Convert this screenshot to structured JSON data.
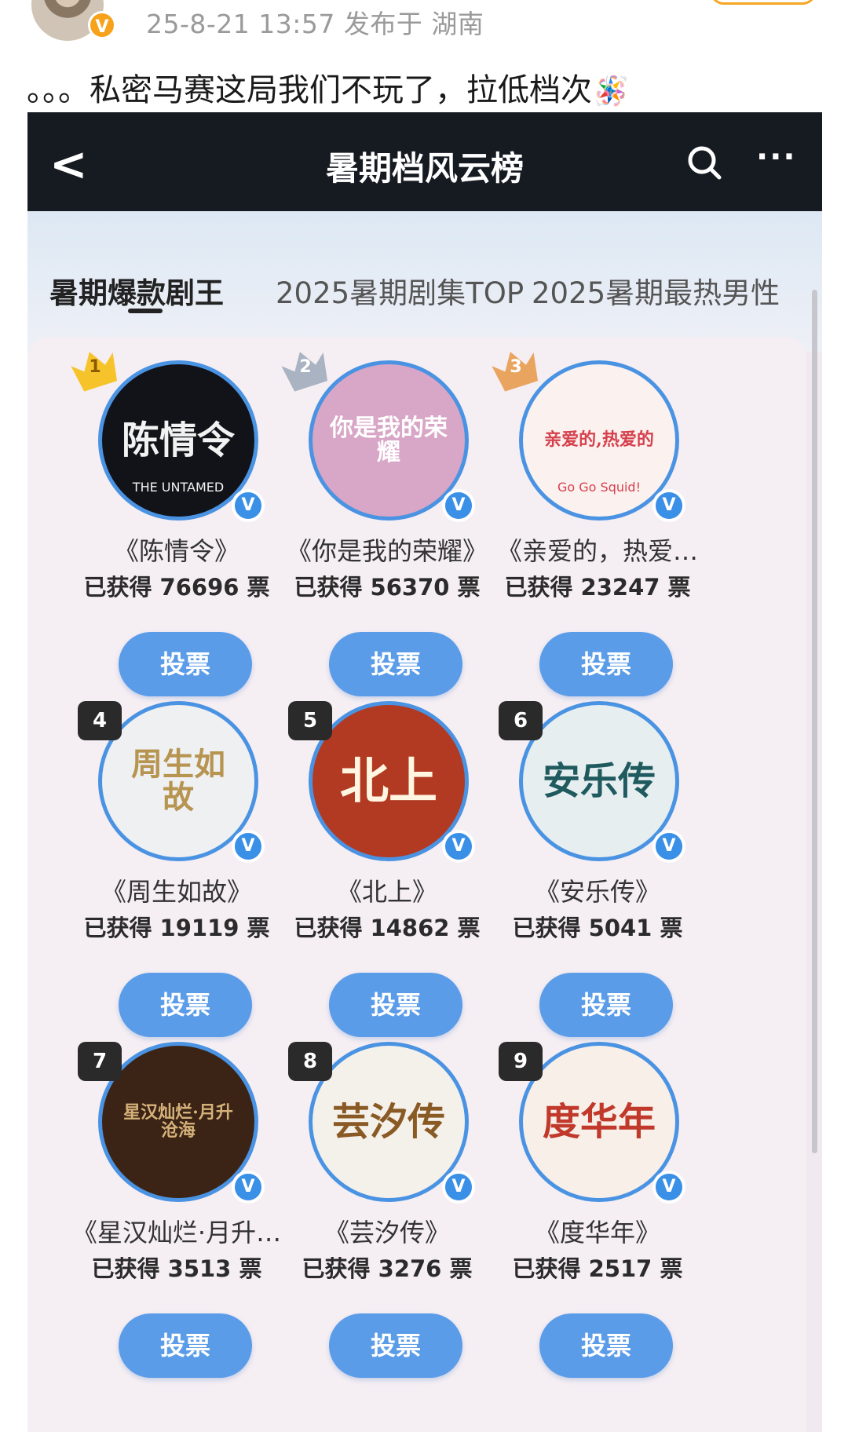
{
  "post": {
    "meta": "25-8-21 13:57  发布于 湖南",
    "text": "。。。私密马赛这局我们不玩了，拉低档次",
    "emoji": "🪅",
    "verified_badge": "V"
  },
  "screen": {
    "nav": {
      "back": "<",
      "title": "暑期档风云榜",
      "more": "···"
    },
    "tabs": [
      {
        "label": "暑期爆款剧王",
        "active": true
      },
      {
        "label": "2025暑期剧集TOP",
        "active": false
      },
      {
        "label": "2025暑期最热男性",
        "active": false
      }
    ],
    "vote_label": "投票",
    "verified_mark": "V",
    "items": [
      {
        "rank": "1",
        "name": "《陈情令》",
        "votes": "已获得 76696 票",
        "poster_title": "陈情令",
        "poster_sub": "THE UNTAMED",
        "poster_bg": "#111319",
        "poster_fg": "#f2f2f2",
        "rank_style": "gold"
      },
      {
        "rank": "2",
        "name": "《你是我的荣耀》",
        "votes": "已获得 56370 票",
        "poster_title": "你是我的荣耀",
        "poster_sub": "",
        "poster_bg": "#d8a6c6",
        "poster_fg": "#ffffff",
        "rank_style": "silver"
      },
      {
        "rank": "3",
        "name": "《亲爱的，热爱…",
        "votes": "已获得 23247 票",
        "poster_title": "亲爱的,热爱的",
        "poster_sub": "Go Go Squid!",
        "poster_bg": "#fbf2f0",
        "poster_fg": "#d6404c",
        "rank_style": "bronze"
      },
      {
        "rank": "4",
        "name": "《周生如故》",
        "votes": "已获得 19119 票",
        "poster_title": "周生如故",
        "poster_sub": "",
        "poster_bg": "#eef0f2",
        "poster_fg": "#b79450",
        "rank_style": "dark"
      },
      {
        "rank": "5",
        "name": "《北上》",
        "votes": "已获得 14862 票",
        "poster_title": "北上",
        "poster_sub": "",
        "poster_bg": "#b23a22",
        "poster_fg": "#fff5e0",
        "rank_style": "dark"
      },
      {
        "rank": "6",
        "name": "《安乐传》",
        "votes": "已获得 5041 票",
        "poster_title": "安乐传",
        "poster_sub": "",
        "poster_bg": "#e6eef0",
        "poster_fg": "#1f5a5e",
        "rank_style": "dark"
      },
      {
        "rank": "7",
        "name": "《星汉灿烂·月升…",
        "votes": "已获得 3513 票",
        "poster_title": "星汉灿烂·月升沧海",
        "poster_sub": "",
        "poster_bg": "#3b2416",
        "poster_fg": "#d6b27a",
        "rank_style": "dark"
      },
      {
        "rank": "8",
        "name": "《芸汐传》",
        "votes": "已获得 3276 票",
        "poster_title": "芸汐传",
        "poster_sub": "",
        "poster_bg": "#f4f0ea",
        "poster_fg": "#8a5a24",
        "rank_style": "dark"
      },
      {
        "rank": "9",
        "name": "《度华年》",
        "votes": "已获得 2517 票",
        "poster_title": "度华年",
        "poster_sub": "",
        "poster_bg": "#f7efe8",
        "poster_fg": "#c0392b",
        "rank_style": "dark"
      }
    ]
  },
  "colors": {
    "accent_blue": "#4a93e3",
    "vote_button": "#5b9ce8",
    "nav_bg": "#161b22",
    "crown_gold": "#f6c42a",
    "crown_silver": "#a9b3c2",
    "crown_bronze": "#e9a560"
  }
}
